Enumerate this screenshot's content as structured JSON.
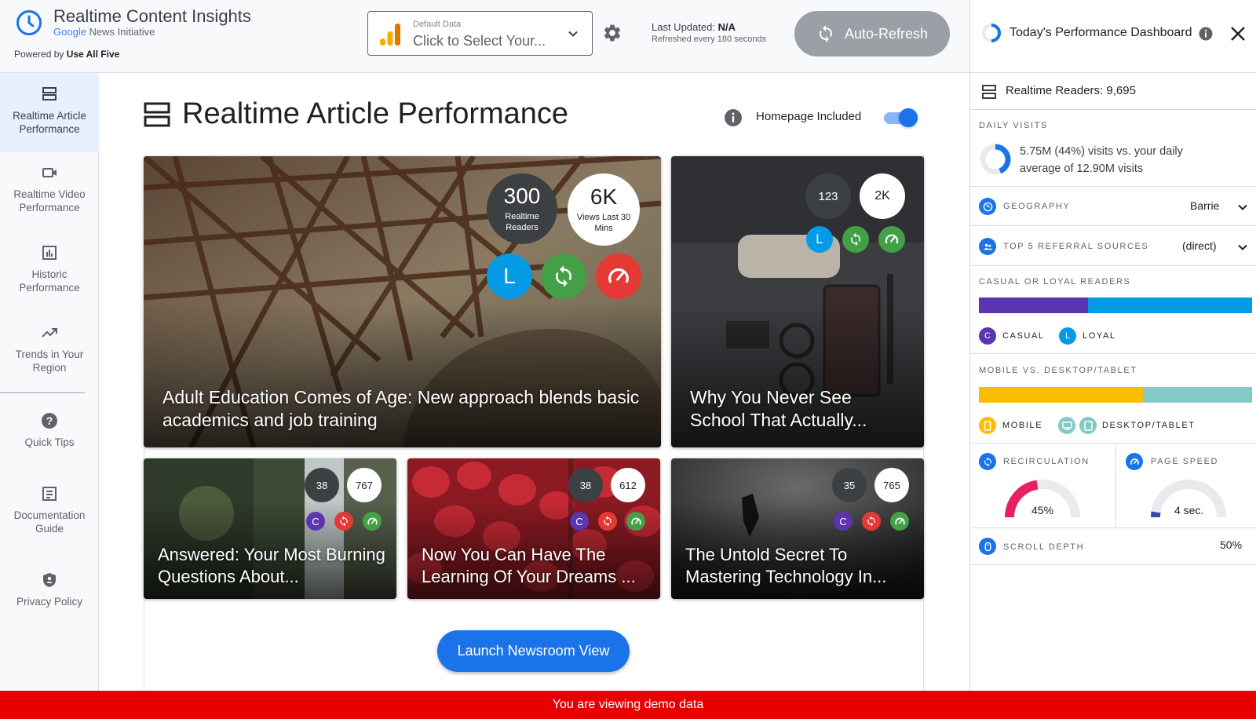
{
  "header": {
    "app_title": "Realtime Content Insights",
    "google_word": "Google",
    "news_initiative": "News Initiative",
    "powered_prefix": "Powered by",
    "powered_brand": "Use All Five",
    "data_source_label": "Default Data",
    "data_source_value": "Click to Select Your...",
    "last_updated_label": "Last Updated:",
    "last_updated_value": "N/A",
    "refresh_note": "Refreshed every 180 seconds",
    "auto_refresh_label": "Auto-Refresh"
  },
  "nav": {
    "items": [
      {
        "label": "Realtime Article Performance",
        "icon": "article-list-icon",
        "active": true
      },
      {
        "label": "Realtime Video Performance",
        "icon": "video-camera-icon",
        "active": false
      },
      {
        "label": "Historic Performance",
        "icon": "bar-chart-icon",
        "active": false
      },
      {
        "label": "Trends in Your Region",
        "icon": "trending-up-icon",
        "active": false
      },
      {
        "label": "Quick Tips",
        "icon": "help-icon",
        "active": false
      },
      {
        "label": "Documentation Guide",
        "icon": "document-icon",
        "active": false
      },
      {
        "label": "Privacy Policy",
        "icon": "shield-icon",
        "active": false
      }
    ]
  },
  "main": {
    "title": "Realtime Article Performance",
    "homepage_label": "Homepage Included",
    "homepage_included": true,
    "launch_label": "Launch Newsroom View",
    "articles": [
      {
        "title": "Adult Education Comes of Age: New approach blends basic academics and job training",
        "realtime": "300",
        "realtime_label": "Realtime Readers",
        "views": "6K",
        "views_label": "Views Last 30 Mins",
        "reader_type": "L"
      },
      {
        "title": "Why You Never See School That Actually...",
        "realtime": "123",
        "views": "2K",
        "reader_type": "L"
      },
      {
        "title": "Answered: Your Most Burning Questions About...",
        "realtime": "38",
        "views": "767",
        "reader_type": "C"
      },
      {
        "title": "Now You Can Have The Learning Of Your Dreams ...",
        "realtime": "38",
        "views": "612",
        "reader_type": "C"
      },
      {
        "title": "The Untold Secret To Mastering Technology In...",
        "realtime": "35",
        "views": "765",
        "reader_type": "C"
      }
    ]
  },
  "demo_notice": "You are viewing demo data",
  "sidebar": {
    "title": "Today's Performance Dashboard",
    "realtime_readers": "Realtime Readers: 9,695",
    "daily_visits_caption": "DAILY VISITS",
    "daily_visits_text": "5.75M (44%) visits vs. your daily average of 12.90M visits",
    "daily_visits_fraction": 0.44,
    "geography_caption": "GEOGRAPHY",
    "geography_value": "Barrie",
    "referral_caption": "TOP 5 REFERRAL SOURCES",
    "referral_value": "(direct)",
    "casual_loyal_caption": "CASUAL OR LOYAL READERS",
    "casual_fraction": 0.4,
    "casual_label": "CASUAL",
    "loyal_label": "LOYAL",
    "casual_letter": "C",
    "loyal_letter": "L",
    "mobile_caption": "MOBILE VS. DESKTOP/TABLET",
    "mobile_fraction": 0.6,
    "mobile_label": "MOBILE",
    "desktop_label": "DESKTOP/TABLET",
    "recirculation_caption": "RECIRCULATION",
    "recirculation_value": "45%",
    "recirculation_fraction": 0.45,
    "page_speed_caption": "PAGE SPEED",
    "page_speed_value": "4 sec.",
    "page_speed_fraction": 0.05,
    "scroll_caption": "SCROLL DEPTH",
    "scroll_value": "50%"
  },
  "colors": {
    "accent": "#1a73e8",
    "casual": "#5e35b1",
    "loyal": "#039be5",
    "mobile": "#fbbc04",
    "desktop": "#80cbc4",
    "recirculation": "#e91e63",
    "page_speed": "#3949ab",
    "demo_bar": "#e60000"
  }
}
